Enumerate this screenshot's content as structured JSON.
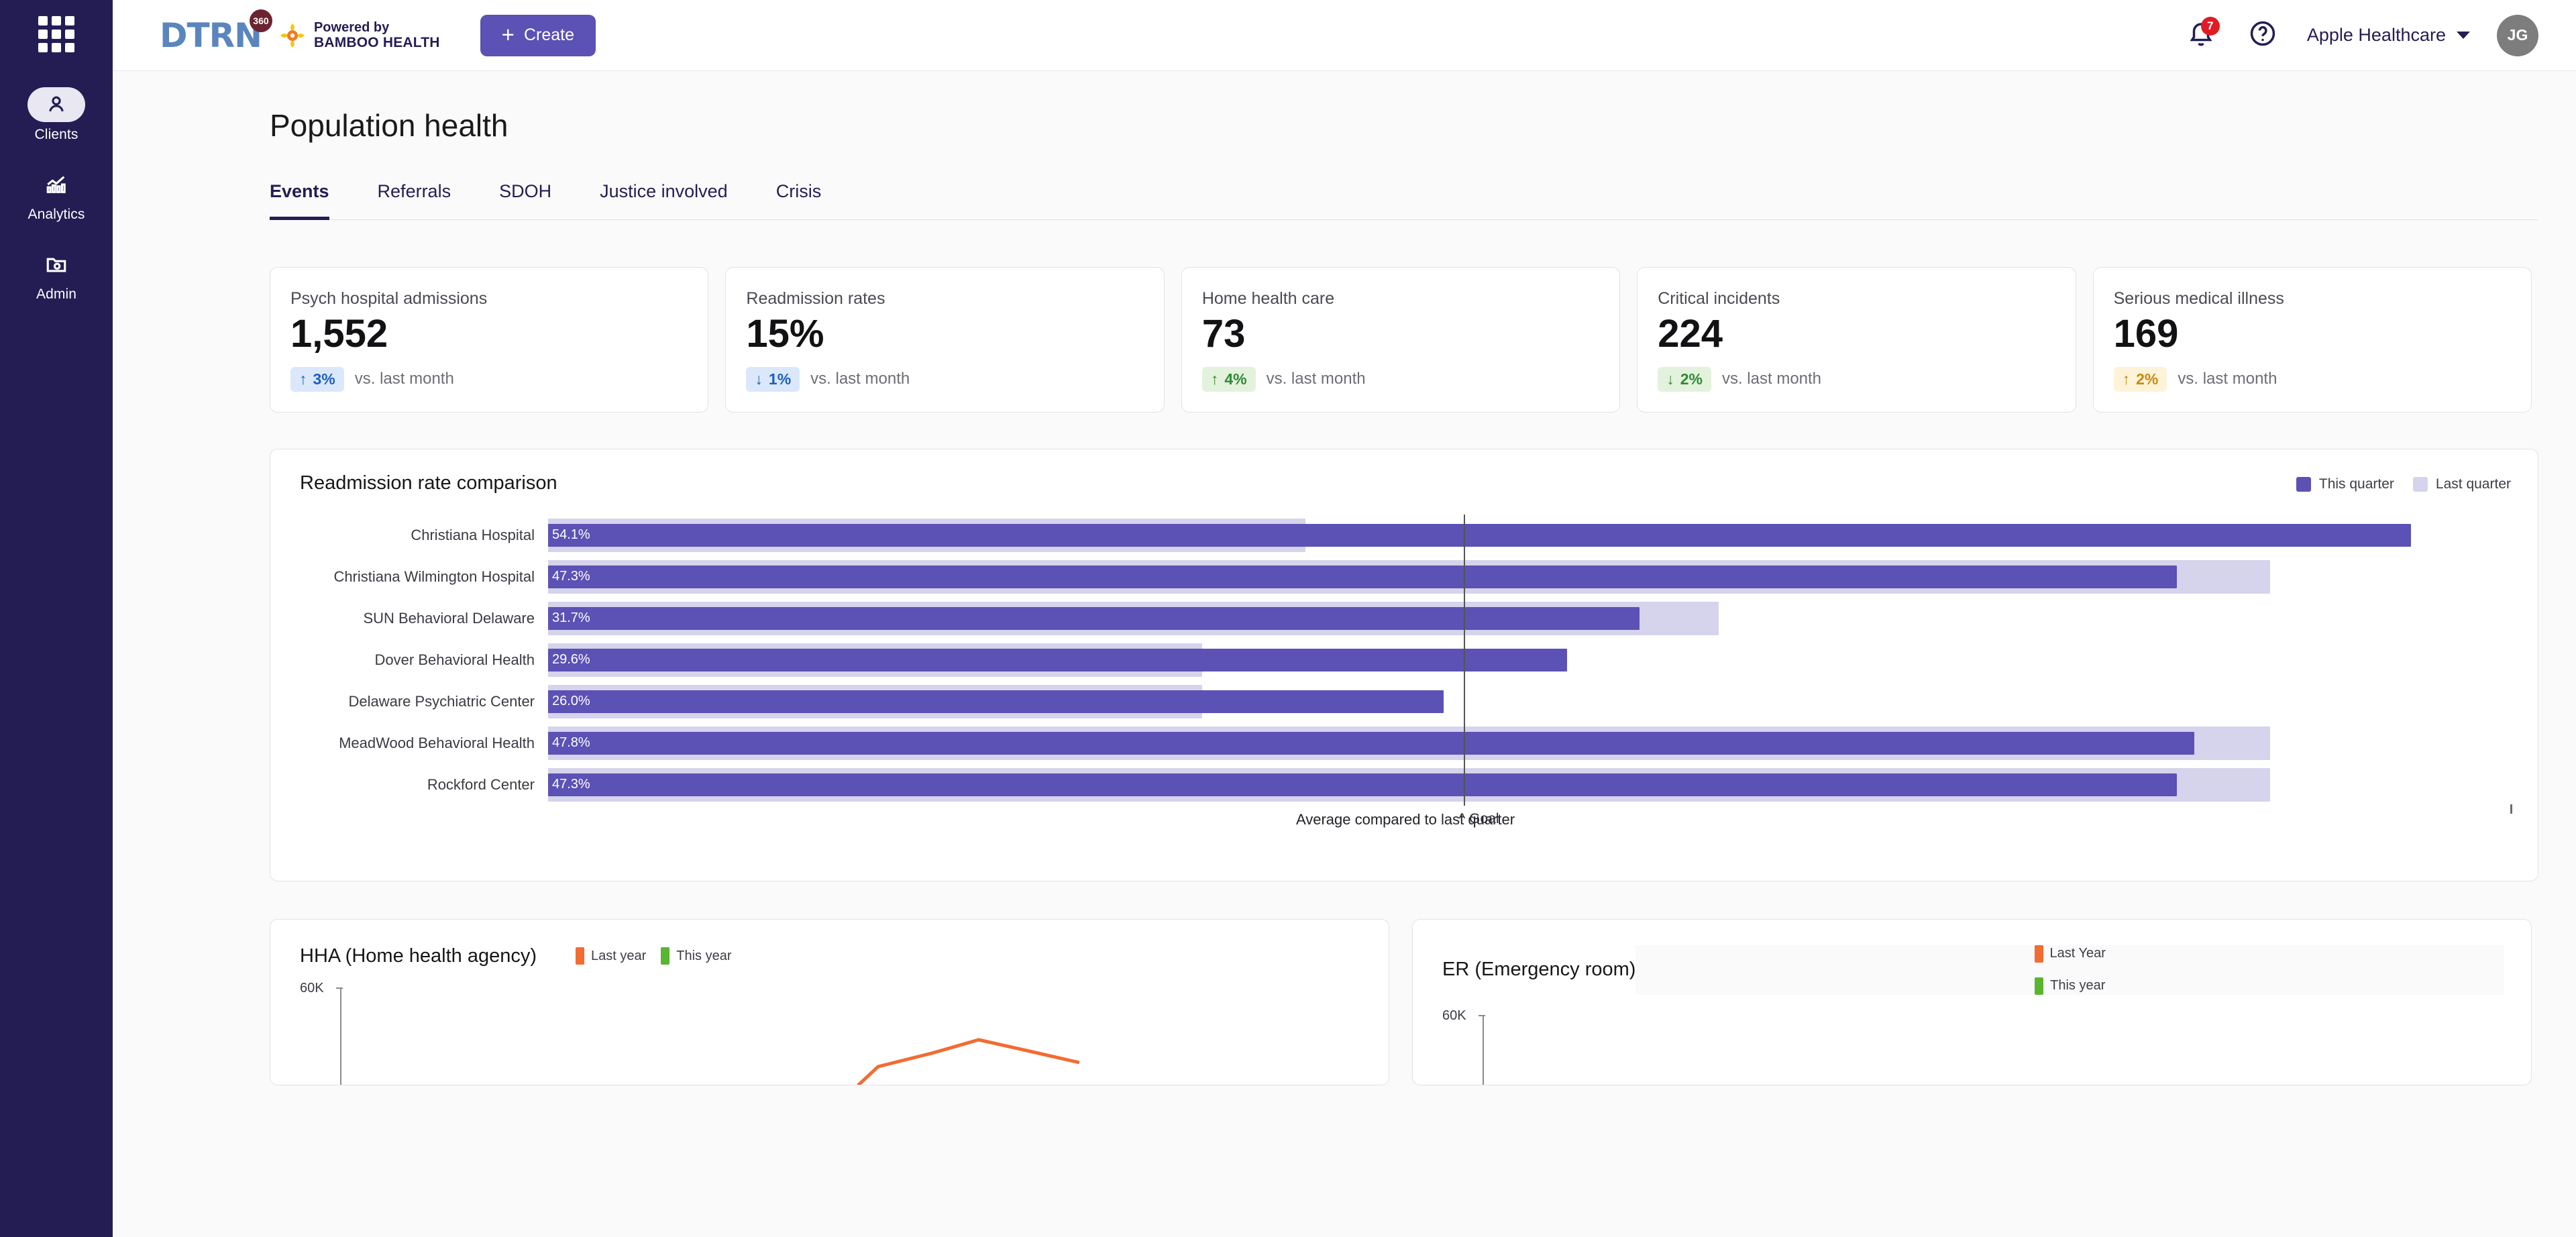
{
  "rail": {
    "app_grid_label": "app-grid",
    "items": [
      {
        "label": "Clients",
        "icon": "person-icon",
        "active": true
      },
      {
        "label": "Analytics",
        "icon": "bar-chart-icon",
        "active": false
      },
      {
        "label": "Admin",
        "icon": "folder-gear-icon",
        "active": false
      }
    ]
  },
  "topbar": {
    "logo_text": "DTRN",
    "logo_badge": "360",
    "powered_by_line1": "Powered by",
    "powered_by_line2": "BAMBOO HEALTH",
    "create_label": "Create",
    "notification_count": "7",
    "org_name": "Apple Healthcare",
    "avatar_initials": "JG"
  },
  "page": {
    "title": "Population health",
    "tabs": [
      {
        "label": "Events",
        "active": true
      },
      {
        "label": "Referrals",
        "active": false
      },
      {
        "label": "SDOH",
        "active": false
      },
      {
        "label": "Justice involved",
        "active": false
      },
      {
        "label": "Crisis",
        "active": false
      }
    ]
  },
  "kpis": [
    {
      "label": "Psych hospital admissions",
      "value": "1,552",
      "delta": "3%",
      "direction": "up",
      "tone": "blue",
      "comparison": "vs. last month"
    },
    {
      "label": "Readmission rates",
      "value": "15%",
      "delta": "1%",
      "direction": "down",
      "tone": "blue",
      "comparison": "vs. last month"
    },
    {
      "label": "Home health care",
      "value": "73",
      "delta": "4%",
      "direction": "up",
      "tone": "green",
      "comparison": "vs. last month"
    },
    {
      "label": "Critical incidents",
      "value": "224",
      "delta": "2%",
      "direction": "down",
      "tone": "green",
      "comparison": "vs. last month"
    },
    {
      "label": "Serious medical illness",
      "value": "169",
      "delta": "2%",
      "direction": "up",
      "tone": "amber",
      "comparison": "vs. last month"
    }
  ],
  "readmission_panel": {
    "title": "Readmission rate comparison",
    "legend": [
      {
        "label": "This quarter",
        "color": "#5c51b5"
      },
      {
        "label": "Last quarter",
        "color": "#d6d3ec"
      }
    ],
    "goal_label": "^ Goal",
    "caption": "Average compared to last quarter"
  },
  "hha_panel": {
    "title": "HHA (Home health agency)",
    "legend": [
      {
        "label": "Last year",
        "color": "#f26c33"
      },
      {
        "label": "This year",
        "color": "#5cb531"
      }
    ],
    "y_top": "60K"
  },
  "er_panel": {
    "title": "ER (Emergency room)",
    "legend": [
      {
        "label": "Last Year",
        "color": "#f26c33"
      },
      {
        "label": "This year",
        "color": "#5cb531"
      }
    ],
    "y_top": "60K"
  },
  "chart_data": [
    {
      "type": "bar",
      "title": "Readmission rate comparison",
      "orientation": "horizontal",
      "categories": [
        "Christiana Hospital",
        "Christiana Wilmington Hospital",
        "SUN Behavioral Delaware",
        "Dover Behavioral Health",
        "Delaware Psychiatric Center",
        "MeadWood Behavioral Health",
        "Rockford Center"
      ],
      "series": [
        {
          "name": "This quarter",
          "color": "#5c51b5",
          "values": [
            54.1,
            47.3,
            31.7,
            29.6,
            26.0,
            47.8,
            47.3
          ],
          "labels": [
            "54.1%",
            "47.3%",
            "31.7%",
            "29.6%",
            "26.0%",
            "47.8%",
            "47.3%"
          ]
        },
        {
          "name": "Last quarter",
          "color": "#d6d3ec",
          "values": [
            22.0,
            50.0,
            34.0,
            19.0,
            19.0,
            50.0,
            50.0
          ]
        }
      ],
      "goal": {
        "label": "^ Goal",
        "value": 26.6
      },
      "xlabel": "",
      "ylabel": "",
      "xlim": [
        0,
        57
      ],
      "grid": false,
      "legend_position": "top-right",
      "annotation": "Average compared to last quarter"
    },
    {
      "type": "line",
      "title": "HHA (Home health agency)",
      "ylabel": "",
      "xlabel": "",
      "ylim": [
        0,
        60000
      ],
      "y_ticks": [
        "60K"
      ],
      "grid": false,
      "legend_position": "top-left",
      "series": [
        {
          "name": "Last year",
          "color": "#f26c33",
          "values": [
            null,
            null,
            null,
            null,
            null,
            30000,
            42000,
            48000,
            40000
          ]
        },
        {
          "name": "This year",
          "color": "#5cb531",
          "values": []
        }
      ],
      "note": "Panel is clipped by the bottom edge of the viewport; only the upper portion of the plot is visible."
    },
    {
      "type": "line",
      "title": "ER (Emergency room)",
      "ylabel": "",
      "xlabel": "",
      "ylim": [
        0,
        60000
      ],
      "y_ticks": [
        "60K"
      ],
      "grid": false,
      "legend_position": "top-right",
      "series": [
        {
          "name": "Last Year",
          "color": "#f26c33",
          "values": []
        },
        {
          "name": "This year",
          "color": "#5cb531",
          "values": []
        }
      ],
      "note": "Panel is clipped by the bottom edge of the viewport; no data line visible in the rendered region."
    }
  ]
}
